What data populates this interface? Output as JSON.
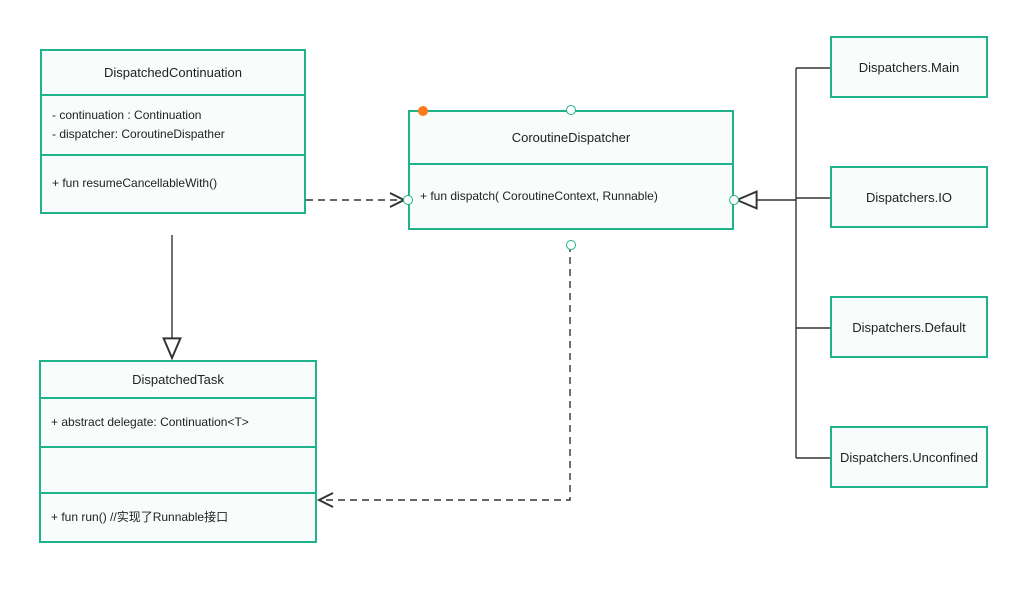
{
  "classes": {
    "dispatchedContinuation": {
      "title": "DispatchedContinuation",
      "fields": [
        "-   continuation : Continuation",
        "-   dispatcher: CoroutineDispather"
      ],
      "methods": [
        "+   fun resumeCancellableWith()"
      ]
    },
    "coroutineDispatcher": {
      "title": "CoroutineDispatcher",
      "methods": [
        "+   fun dispatch( CoroutineContext, Runnable)"
      ]
    },
    "dispatchedTask": {
      "title": "DispatchedTask",
      "fields": [
        "+  abstract delegate: Continuation<T>"
      ],
      "methods": [
        "+   fun run()  //实现了Runnable接口"
      ]
    }
  },
  "dispatchers": {
    "main": "Dispatchers.Main",
    "io": "Dispatchers.IO",
    "default": "Dispatchers.Default",
    "unconfined": "Dispatchers.Unconfined"
  },
  "colors": {
    "border": "#20b28a",
    "accent": "#ff7a1a"
  },
  "chart_data": {
    "type": "uml-class-diagram",
    "nodes": [
      {
        "id": "DispatchedContinuation",
        "kind": "class",
        "attributes": [
          "- continuation : Continuation",
          "- dispatcher: CoroutineDispather"
        ],
        "operations": [
          "+ fun resumeCancellableWith()"
        ]
      },
      {
        "id": "CoroutineDispatcher",
        "kind": "class",
        "operations": [
          "+ fun dispatch( CoroutineContext, Runnable)"
        ]
      },
      {
        "id": "DispatchedTask",
        "kind": "class",
        "attributes": [
          "+ abstract delegate: Continuation<T>"
        ],
        "operations": [
          "+ fun run()  //实现了Runnable接口"
        ]
      },
      {
        "id": "Dispatchers.Main",
        "kind": "class"
      },
      {
        "id": "Dispatchers.IO",
        "kind": "class"
      },
      {
        "id": "Dispatchers.Default",
        "kind": "class"
      },
      {
        "id": "Dispatchers.Unconfined",
        "kind": "class"
      }
    ],
    "edges": [
      {
        "from": "DispatchedContinuation",
        "to": "CoroutineDispatcher",
        "type": "dependency-dashed-open-arrow"
      },
      {
        "from": "DispatchedContinuation",
        "to": "DispatchedTask",
        "type": "generalization-solid-hollow-arrow"
      },
      {
        "from": "CoroutineDispatcher",
        "to": "DispatchedTask",
        "type": "dependency-dashed-open-arrow"
      },
      {
        "from": "Dispatchers.Main",
        "to": "CoroutineDispatcher",
        "type": "realization-hollow-arrow"
      },
      {
        "from": "Dispatchers.IO",
        "to": "CoroutineDispatcher",
        "type": "realization-hollow-arrow"
      },
      {
        "from": "Dispatchers.Default",
        "to": "CoroutineDispatcher",
        "type": "realization-hollow-arrow"
      },
      {
        "from": "Dispatchers.Unconfined",
        "to": "CoroutineDispatcher",
        "type": "realization-hollow-arrow"
      }
    ]
  }
}
